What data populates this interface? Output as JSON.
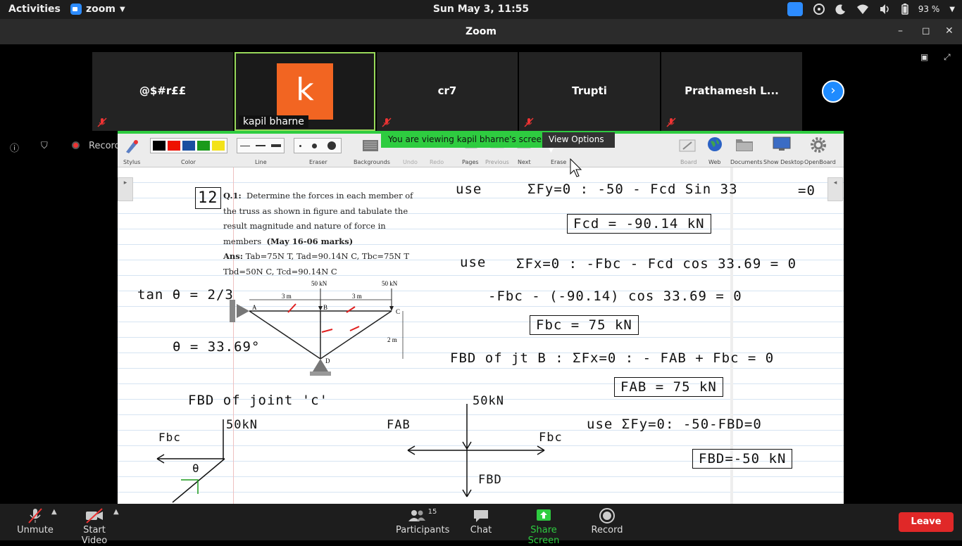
{
  "topbar": {
    "activities": "Activities",
    "app_name": "zoom",
    "clock": "Sun May  3, 11:55",
    "battery": "93 %"
  },
  "window": {
    "title": "Zoom"
  },
  "participants": [
    {
      "name": "@$#r££",
      "muted": true
    },
    {
      "name": "kapil bharne",
      "avatar_letter": "k",
      "active_speaker": true
    },
    {
      "name": "cr7",
      "muted": true
    },
    {
      "name": "Trupti",
      "muted": true
    },
    {
      "name": "Prathamesh L...",
      "muted": true
    }
  ],
  "meeting": {
    "recording_label": "Recording"
  },
  "share": {
    "banner": "You are viewing kapil bharne's screen",
    "view_options": "View Options"
  },
  "whiteboard_toolbar": {
    "left": [
      "Stylus",
      "Color",
      "Line",
      "Eraser",
      "Backgrounds",
      "Undo",
      "Redo",
      "Pages",
      "Previous",
      "Next",
      "Erase"
    ],
    "right": [
      "Board",
      "Web",
      "Documents",
      "Show Desktop",
      "OpenBoard"
    ]
  },
  "problem": {
    "number": "12",
    "tag": "Q.1:",
    "text": "Determine the forces in each member of the truss as shown in figure and tabulate the result magnitude and nature of force in members",
    "marks": "(May 16-06 marks)",
    "ans_label": "Ans:",
    "answer_line1": "Tab=75N T, Tad=90.14N C, Tbc=75N T",
    "answer_line2": "Tbd=50N C, Tcd=90.14N C"
  },
  "truss": {
    "load_b": "50 kN",
    "load_c": "50 kN",
    "span_1": "3 m",
    "span_2": "3 m",
    "height": "2 m",
    "node_a": "A",
    "node_b": "B",
    "node_c": "C",
    "node_d": "D"
  },
  "handwriting": {
    "tan": "tan θ = 2/3",
    "theta": "θ = 33.69°",
    "use1": "use",
    "eq1": "ΣFy=0 : -50 - Fcd Sin 33",
    "eq1_tail": "=0",
    "box1": "Fcd = -90.14 kN",
    "use2": "use",
    "eq2": "ΣFx=0 : -Fbc - Fcd cos 33.69 = 0",
    "eq3": "-Fbc - (-90.14) cos 33.69 = 0",
    "box2": "Fbc = 75 kN",
    "fbd_b": "FBD of jt B  :  ΣFx=0 : - FAB + Fbc = 0",
    "box3": "FAB = 75 kN",
    "fbd_c": "FBD of joint 'c'",
    "load_50": "50kN",
    "load_50b": "50kN",
    "fbc": "Fbc",
    "fab": "FAB",
    "fbc2": "Fbc",
    "fbd": "FBD",
    "theta_small": "θ",
    "eq4": "use ΣFy=0: -50-FBD=0",
    "box4": "FBD=-50 kN"
  },
  "bottombar": {
    "unmute": "Unmute",
    "start_video": "Start Video",
    "participants": "Participants",
    "participants_count": "15",
    "chat": "Chat",
    "share_screen": "Share Screen",
    "record": "Record",
    "leave": "Leave"
  },
  "colors": {
    "zoom_blue": "#2d8cff",
    "share_green": "#2ecc40",
    "avatar_orange": "#f26522",
    "leave_red": "#e02828",
    "ink_red": "#e02020",
    "ink_green": "#1a9a1a"
  }
}
